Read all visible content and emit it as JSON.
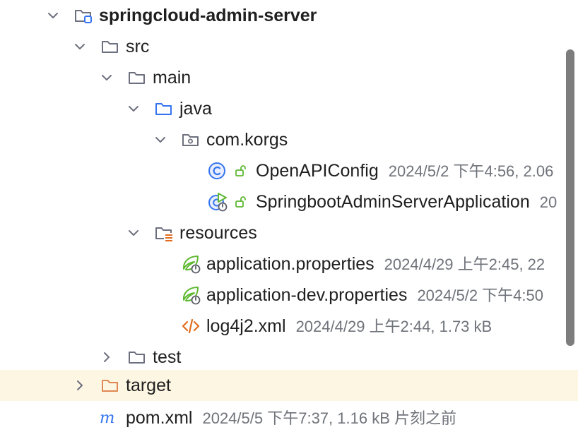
{
  "tree": {
    "root": {
      "label": "springcloud-admin-server"
    },
    "src": {
      "label": "src"
    },
    "main": {
      "label": "main"
    },
    "java": {
      "label": "java"
    },
    "package": {
      "label": "com.korgs"
    },
    "openapi": {
      "label": "OpenAPIConfig",
      "meta": "2024/5/2 下午4:56, 2.06"
    },
    "springapp": {
      "label": "SpringbootAdminServerApplication",
      "meta": "20"
    },
    "resources": {
      "label": "resources"
    },
    "app_props": {
      "label": "application.properties",
      "meta": "2024/4/29 上午2:45, 22"
    },
    "app_dev_props": {
      "label": "application-dev.properties",
      "meta": "2024/5/2 下午4:50"
    },
    "log4j2": {
      "label": "log4j2.xml",
      "meta": "2024/4/29 上午2:44, 1.73 kB"
    },
    "test": {
      "label": "test"
    },
    "target": {
      "label": "target"
    },
    "pom": {
      "label": "pom.xml",
      "meta": "2024/5/5 下午7:37, 1.16 kB 片刻之前"
    }
  },
  "colors": {
    "folder_stroke": "#6c707e",
    "source_folder": "#3574f0",
    "excluded_folder": "#e08855",
    "class_icon": "#3574f0",
    "spring_icon": "#5fb832",
    "xml_icon": "#e06c1f",
    "maven_icon": "#3574f0",
    "highlight_row": "#fdf6e3",
    "meta_text": "#6f737a"
  }
}
